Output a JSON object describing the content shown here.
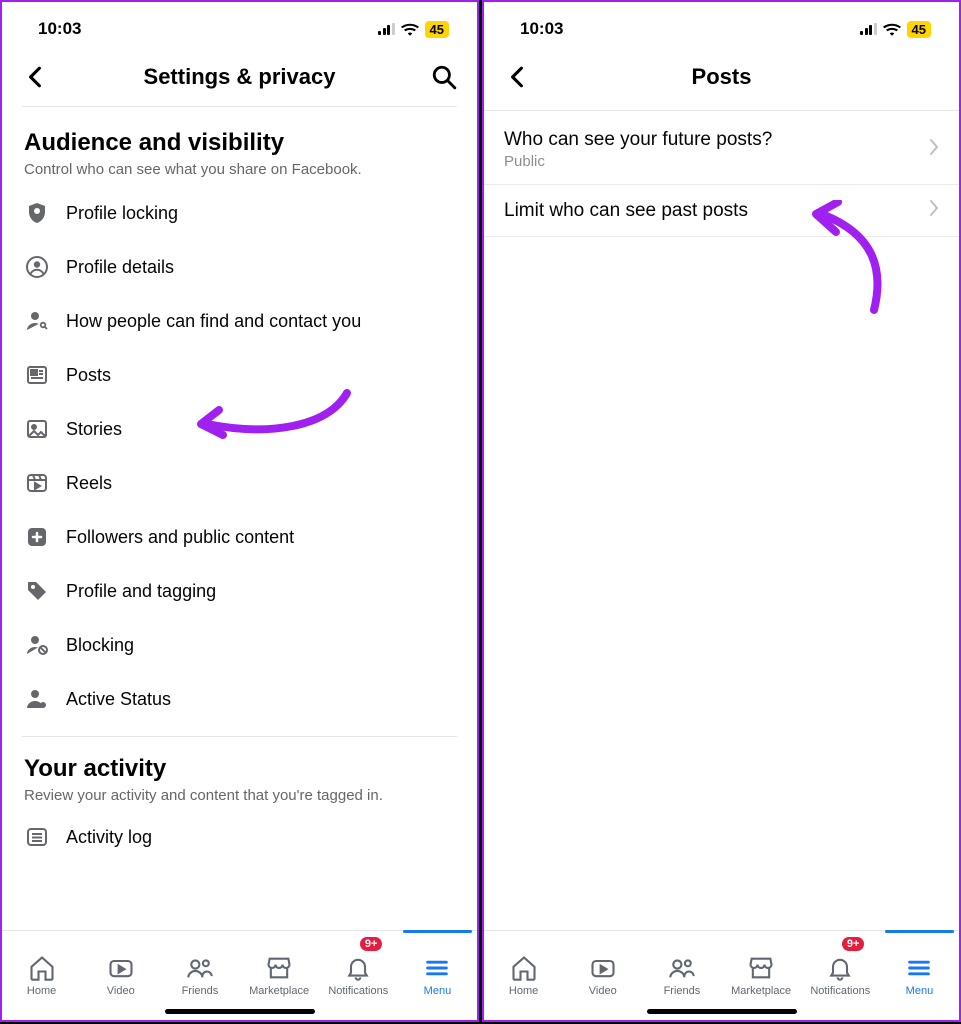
{
  "status": {
    "time": "10:03",
    "battery": "45"
  },
  "left": {
    "header_title": "Settings & privacy",
    "section1": {
      "title": "Audience and visibility",
      "subtitle": "Control who can see what you share on Facebook."
    },
    "rows": [
      {
        "label": "Profile locking"
      },
      {
        "label": "Profile details"
      },
      {
        "label": "How people can find and contact you"
      },
      {
        "label": "Posts"
      },
      {
        "label": "Stories"
      },
      {
        "label": "Reels"
      },
      {
        "label": "Followers and public content"
      },
      {
        "label": "Profile and tagging"
      },
      {
        "label": "Blocking"
      },
      {
        "label": "Active Status"
      }
    ],
    "section2": {
      "title": "Your activity",
      "subtitle": "Review your activity and content that you're tagged in."
    },
    "rows2": [
      {
        "label": "Activity log"
      }
    ]
  },
  "right": {
    "header_title": "Posts",
    "rows": [
      {
        "title": "Who can see your future posts?",
        "sub": "Public"
      },
      {
        "title": "Limit who can see past posts"
      }
    ]
  },
  "nav": {
    "tabs": [
      {
        "label": "Home"
      },
      {
        "label": "Video"
      },
      {
        "label": "Friends"
      },
      {
        "label": "Marketplace"
      },
      {
        "label": "Notifications",
        "badge": "9+"
      },
      {
        "label": "Menu"
      }
    ]
  }
}
